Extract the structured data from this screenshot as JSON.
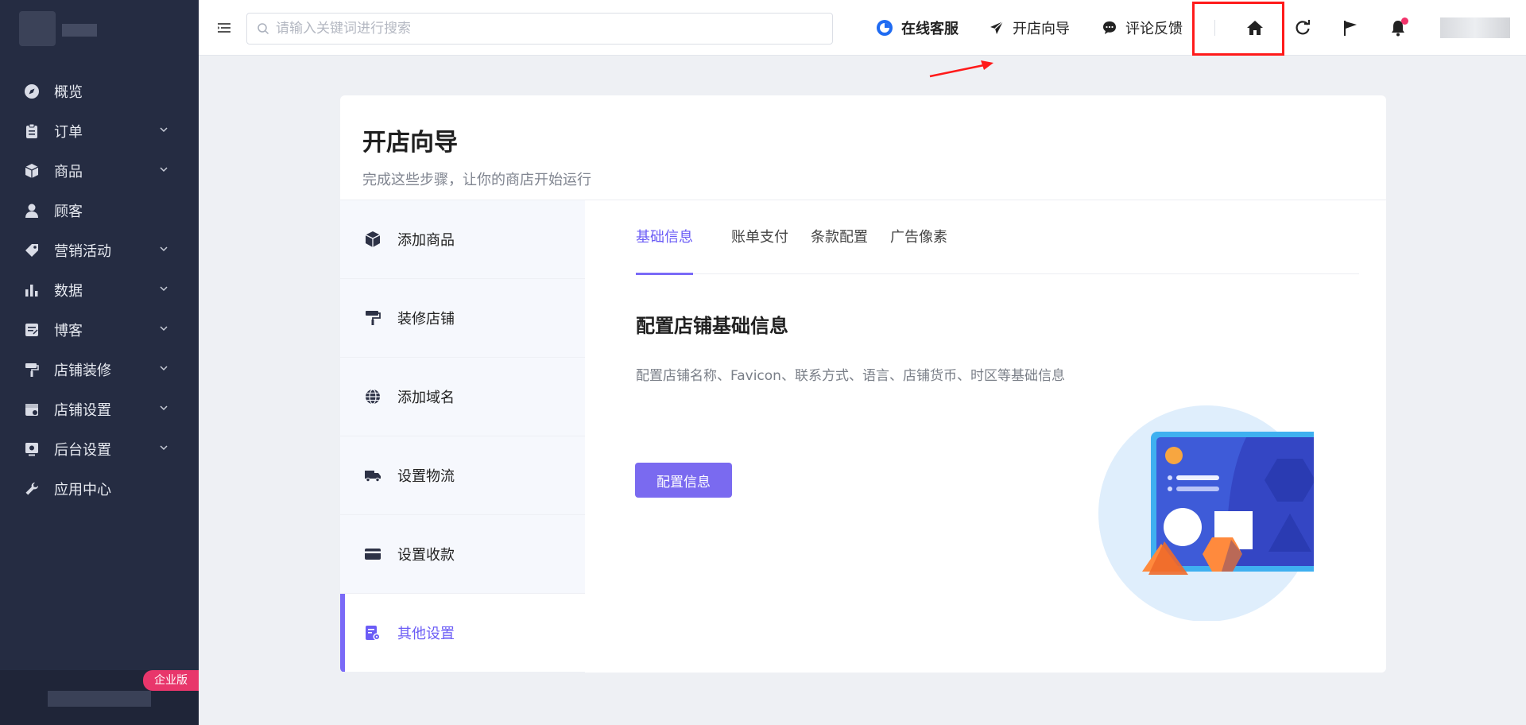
{
  "sidebar": {
    "items": [
      {
        "label": "概览",
        "icon": "compass-icon",
        "expandable": false
      },
      {
        "label": "订单",
        "icon": "clipboard-icon",
        "expandable": true
      },
      {
        "label": "商品",
        "icon": "box-icon",
        "expandable": true
      },
      {
        "label": "顾客",
        "icon": "user-icon",
        "expandable": false
      },
      {
        "label": "营销活动",
        "icon": "tag-icon",
        "expandable": true
      },
      {
        "label": "数据",
        "icon": "bar-chart-icon",
        "expandable": true
      },
      {
        "label": "博客",
        "icon": "note-icon",
        "expandable": true
      },
      {
        "label": "店铺装修",
        "icon": "paint-roller-icon",
        "expandable": true
      },
      {
        "label": "店铺设置",
        "icon": "store-settings-icon",
        "expandable": true
      },
      {
        "label": "后台设置",
        "icon": "admin-settings-icon",
        "expandable": true
      },
      {
        "label": "应用中心",
        "icon": "wrench-icon",
        "expandable": false
      }
    ],
    "edition_badge": "企业版"
  },
  "topbar": {
    "search_placeholder": "请输入关键词进行搜索",
    "online_service": "在线客服",
    "store_guide": "开店向导",
    "feedback": "评论反馈"
  },
  "page": {
    "title": "开店向导",
    "subtitle": "完成这些步骤，让你的商店开始运行"
  },
  "steps": [
    {
      "label": "添加商品",
      "icon": "cube-icon"
    },
    {
      "label": "装修店铺",
      "icon": "paint-roller-icon"
    },
    {
      "label": "添加域名",
      "icon": "globe-icon"
    },
    {
      "label": "设置物流",
      "icon": "truck-icon"
    },
    {
      "label": "设置收款",
      "icon": "credit-card-icon"
    },
    {
      "label": "其他设置",
      "icon": "settings-doc-icon",
      "active": true
    }
  ],
  "tabs": [
    {
      "label": "基础信息",
      "active": true
    },
    {
      "label": "账单支付"
    },
    {
      "label": "条款配置"
    },
    {
      "label": "广告像素"
    }
  ],
  "section": {
    "title": "配置店铺基础信息",
    "description": "配置店铺名称、Favicon、联系方式、语言、店铺货币、时区等基础信息",
    "button": "配置信息"
  },
  "colors": {
    "sidebar_bg": "#252c42",
    "accent": "#7a6af0",
    "highlight": "#ff1a1a",
    "badge": "#e8366b"
  }
}
